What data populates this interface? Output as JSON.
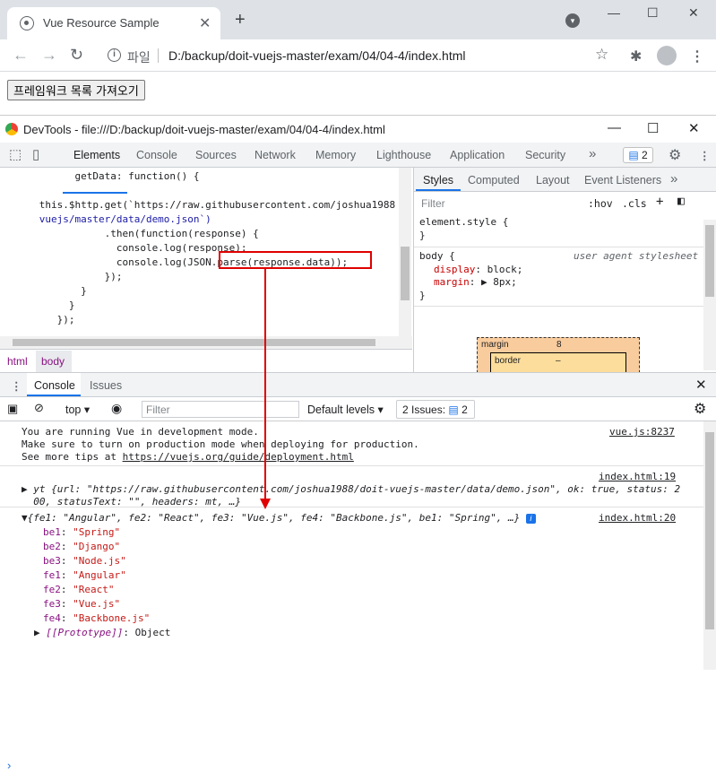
{
  "browser": {
    "tab_title": "Vue Resource Sample",
    "tab_close": "✕",
    "new_tab": "+",
    "address_label": "파일",
    "address_url": "D:/backup/doit-vuejs-master/exam/04/04-4/index.html"
  },
  "page": {
    "button_label": "프레임워크 목록 가져오기"
  },
  "devtools": {
    "title": "DevTools - file:///D:/backup/doit-vuejs-master/exam/04/04-4/index.html",
    "tabs": [
      "Elements",
      "Console",
      "Sources",
      "Network",
      "Memory",
      "Lighthouse",
      "Application",
      "Security"
    ],
    "more": "»",
    "issues_count": "2",
    "code_lines": [
      "            getData: function() {",
      "",
      "      this.$http.get(`https://raw.githubusercontent.com/joshua1988",
      "      vuejs/master/data/demo.json`)",
      "                 .then(function(response) {",
      "                   console.log(response);",
      "                   console.log(JSON.parse(response.data));",
      "                 });",
      "             }",
      "           }",
      "         });"
    ],
    "breadcrumbs": [
      "html",
      "body"
    ],
    "styles_tabs": [
      "Styles",
      "Computed",
      "Layout",
      "Event Listeners"
    ],
    "styles_filter": "Filter",
    "hov": ":hov",
    "cls": ".cls",
    "element_style": "element.style {",
    "close_brace": "}",
    "body_rule": "body {",
    "user_agent": "user agent stylesheet",
    "display_prop": "display",
    "display_val": "block;",
    "margin_prop": "margin",
    "margin_val": "8px;",
    "box_margin_label": "margin",
    "box_margin_value": "8",
    "box_border_label": "border",
    "box_border_value": "–"
  },
  "console": {
    "drawer_tabs": [
      "Console",
      "Issues"
    ],
    "context": "top",
    "filter_placeholder": "Filter",
    "levels": "Default levels",
    "issues_label": "2 Issues:",
    "issues_count": "2",
    "vue_msg_1": "You are running Vue in development mode.",
    "vue_msg_2": "Make sure to turn on production mode when deploying for production.",
    "vue_msg_3_prefix": "See more tips at ",
    "vue_msg_3_link": "https://vuejs.org/guide/deployment.html",
    "vue_src": "vue.js:8237",
    "log1_src": "index.html:19",
    "log1_line1": "▶ yt {url: \"https://raw.githubusercontent.com/joshua1988/doit-vuejs-master/data/demo.json\", ok: true, status: 2",
    "log1_line2": "  00, statusText: \"\", headers: mt, …}",
    "log2_src": "index.html:20",
    "log2_header": "▼{fe1: \"Angular\", fe2: \"React\", fe3: \"Vue.js\", fe4: \"Backbone.js\", be1: \"Spring\", …}",
    "props": [
      {
        "k": "be1",
        "v": "\"Spring\""
      },
      {
        "k": "be2",
        "v": "\"Django\""
      },
      {
        "k": "be3",
        "v": "\"Node.js\""
      },
      {
        "k": "fe1",
        "v": "\"Angular\""
      },
      {
        "k": "fe2",
        "v": "\"React\""
      },
      {
        "k": "fe3",
        "v": "\"Vue.js\""
      },
      {
        "k": "fe4",
        "v": "\"Backbone.js\""
      }
    ],
    "prototype_key": "[[Prototype]]",
    "prototype_val": "Object",
    "info_glyph": "i",
    "prompt": "›"
  },
  "colors": {
    "highlight": "#e00000",
    "accent": "#1a73e8"
  }
}
